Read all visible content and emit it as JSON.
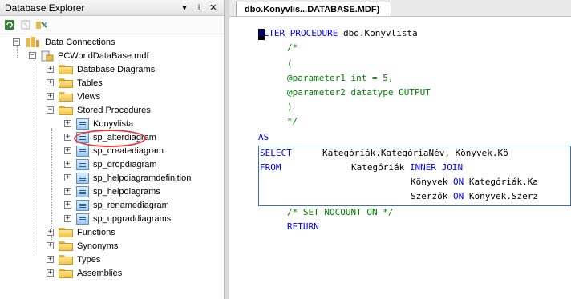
{
  "explorer": {
    "title": "Database Explorer",
    "pin_glyph": "▾",
    "dock_glyph": "⊥",
    "close_glyph": "✕",
    "toolbar": {
      "refresh_icon": "refresh-icon",
      "stop_icon": "stop-icon",
      "connect_icon": "connect-database-icon"
    },
    "tree": {
      "root": "Data Connections",
      "database": "PCWorldDataBase.mdf",
      "folders": {
        "diagrams": "Database Diagrams",
        "tables": "Tables",
        "views": "Views",
        "procedures": "Stored Procedures",
        "functions": "Functions",
        "synonyms": "Synonyms",
        "types": "Types",
        "assemblies": "Assemblies"
      },
      "procedures": [
        "Konyvlista",
        "sp_alterdiagram",
        "sp_creatediagram",
        "sp_dropdiagram",
        "sp_helpdiagramdefinition",
        "sp_helpdiagrams",
        "sp_renamediagram",
        "sp_upgraddiagrams"
      ],
      "expand_plus": "+",
      "expand_minus": "−"
    }
  },
  "editor": {
    "tab_label": "dbo.Konyvlis...DATABASE.MDF)",
    "lines": {
      "l1_kw": "ALTER PROCEDURE",
      "l1_tx": " dbo.Konyvlista",
      "l2": "/*",
      "l3": "(",
      "l4": "@parameter1 int = 5,",
      "l5": "@parameter2 datatype OUTPUT",
      "l6": ")",
      "l7": "*/",
      "l8": "AS",
      "l9_kw": "SELECT",
      "l9_tx": "Kategóriák.KategóriaNév, Könyvek.Kö",
      "l10_kw": "FROM",
      "l10_tx1": "Kategóriák ",
      "l10_kw2": "INNER JOIN",
      "l11_tx1": "Könyvek ",
      "l11_kw": "ON",
      "l11_tx2": " Kategóriák.Ka",
      "l12_tx1": "Szerzők ",
      "l12_kw": "ON",
      "l12_tx2": " Könyvek.Szerz",
      "l13": "/* SET NOCOUNT ON */",
      "l14": "RETURN"
    }
  }
}
